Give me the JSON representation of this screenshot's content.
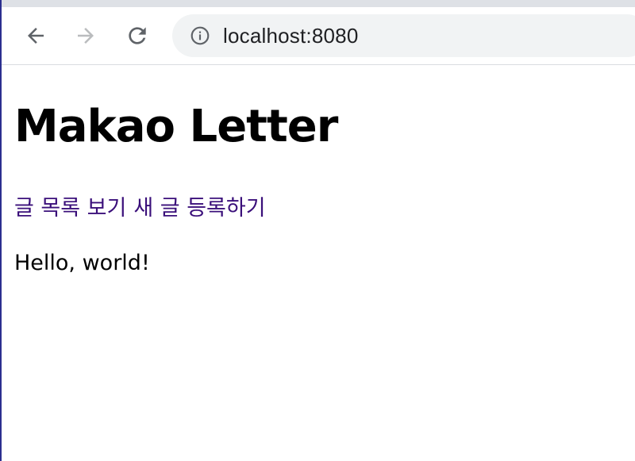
{
  "browser": {
    "url": "localhost:8080",
    "icons": {
      "back": "arrow-left-icon",
      "forward": "arrow-right-icon",
      "reload": "reload-icon",
      "site_info": "info-circle-icon"
    },
    "forward_enabled": false
  },
  "page": {
    "title": "Makao Letter",
    "links": [
      {
        "label": "글 목록 보기"
      },
      {
        "label": "새 글 등록하기"
      }
    ],
    "message": "Hello, world!"
  },
  "colors": {
    "link_visited": "#3a0f7a",
    "toolbar_bg": "#ffffff",
    "omnibox_bg": "#f1f3f4",
    "icon_active": "#5f6368",
    "icon_disabled": "#babcbe"
  }
}
